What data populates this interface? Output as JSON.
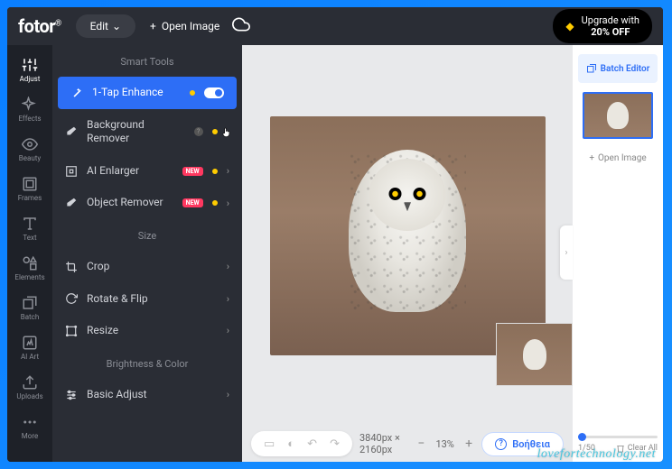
{
  "header": {
    "logo": "fotor",
    "edit_label": "Edit",
    "open_image_label": "Open Image",
    "upgrade_line1": "Upgrade with",
    "upgrade_line2": "20% OFF"
  },
  "sidebar": {
    "items": [
      {
        "label": "Adjust"
      },
      {
        "label": "Effects"
      },
      {
        "label": "Beauty"
      },
      {
        "label": "Frames"
      },
      {
        "label": "Text"
      },
      {
        "label": "Elements"
      },
      {
        "label": "Batch"
      },
      {
        "label": "AI Art"
      },
      {
        "label": "Uploads"
      },
      {
        "label": "More"
      }
    ]
  },
  "tools": {
    "section_smart": "Smart Tools",
    "section_size": "Size",
    "section_brightness": "Brightness & Color",
    "items": {
      "enhance": "1-Tap Enhance",
      "bg_remover": "Background Remover",
      "ai_enlarger": "AI Enlarger",
      "object_remover": "Object Remover",
      "crop": "Crop",
      "rotate": "Rotate & Flip",
      "resize": "Resize",
      "basic_adjust": "Basic Adjust"
    },
    "new_badge": "NEW"
  },
  "canvas": {
    "dimensions": "3840px × 2160px",
    "zoom": "13%"
  },
  "right": {
    "batch_editor": "Batch Editor",
    "open_image": "Open Image",
    "page_indicator": "1/50",
    "clear_all": "Clear All"
  },
  "help_label": "Βοήθεια",
  "watermark": "lovefortechnology.net"
}
